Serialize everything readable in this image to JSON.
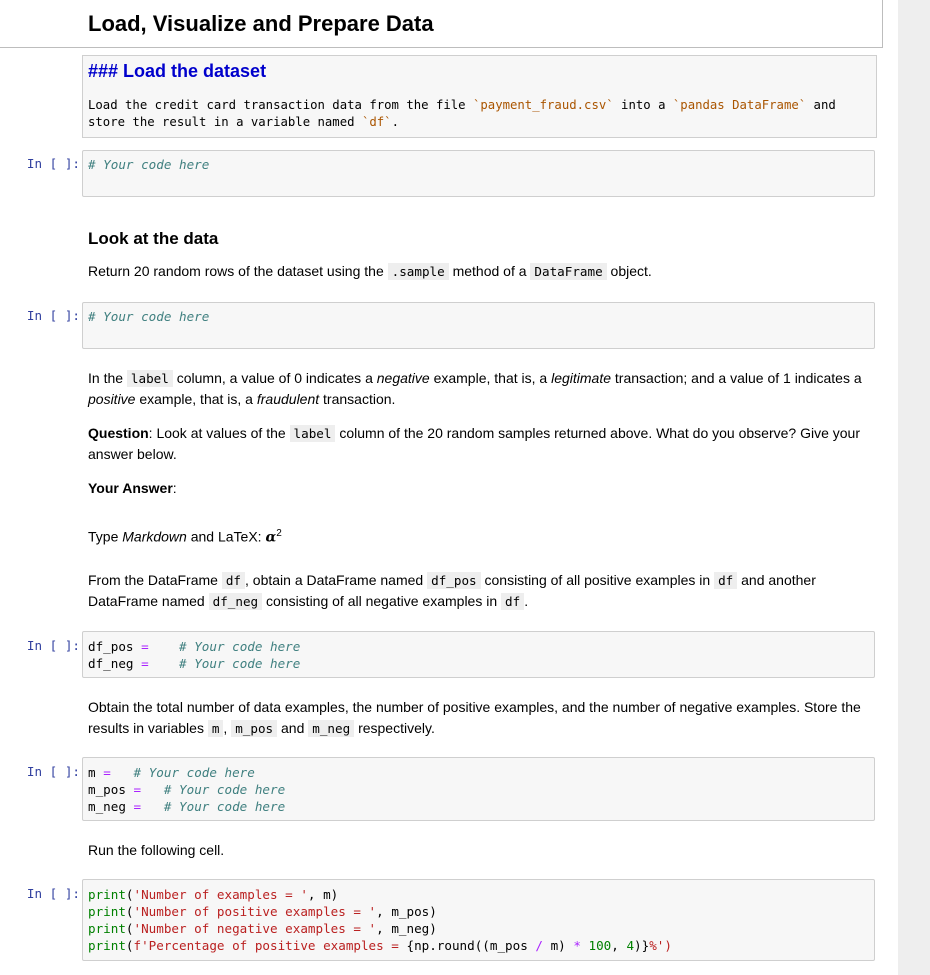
{
  "notebook": {
    "section_title": "Load, Visualize and Prepare Data",
    "prompt_label": "In [ ]:",
    "load_cell": {
      "heading": "### Load the dataset",
      "line1_a": "Load the credit card transaction data from the file ",
      "line1_file": "`payment_fraud.csv`",
      "line1_b": " into a ",
      "line1_df": "`pandas DataFrame`",
      "line1_c": " and",
      "line2_a": "store the result in a variable named ",
      "line2_var": "`df`",
      "line2_b": "."
    },
    "code_cell_1": {
      "comment": "# Your code here"
    },
    "look_section": {
      "heading": "Look at the data",
      "text_a": "Return 20 random rows of the dataset using the ",
      "code_sample": ".sample",
      "text_b": " method of a ",
      "code_dataframe": "DataFrame",
      "text_c": " object."
    },
    "code_cell_2": {
      "comment": "# Your code here"
    },
    "label_paragraph": {
      "t1": "In the ",
      "code_label": "label",
      "t2": " column, a value of 0 indicates a ",
      "negative": "negative",
      "t3": " example, that is, a ",
      "legitimate": "legitimate",
      "t4": " transaction; and a value of 1 indicates a",
      "positive": "positive",
      "t5": " example, that is, a ",
      "fraudulent": "fraudulent",
      "t6": " transaction."
    },
    "question": {
      "bold": "Question",
      "t1": ": Look at values of the ",
      "code_label": "label",
      "t2": " column of the 20 random samples returned above. What do you observe? Give your",
      "t3": "answer below."
    },
    "answer": {
      "bold": "Your Answer",
      "colon": ":"
    },
    "markdown_hint": {
      "t1": "Type ",
      "italic": "Markdown",
      "t2": " and LaTeX: ",
      "alpha": "α",
      "sup": "2"
    },
    "split_paragraph": {
      "t1": "From the DataFrame ",
      "df": "df",
      "t2": ", obtain a DataFrame named ",
      "df_pos": "df_pos",
      "t3": " consisting of all positive examples in ",
      "df2": "df",
      "t4": " and another",
      "t5": "DataFrame named ",
      "df_neg": "df_neg",
      "t6": " consisting of all negative examples in ",
      "df3": "df",
      "t7": "."
    },
    "code_cell_3": {
      "l1_var": "df_pos",
      "l1_op": "=",
      "l1_comment": "# Your code here",
      "l2_var": "df_neg",
      "l2_op": "=",
      "l2_comment": "# Your code here"
    },
    "count_paragraph": {
      "t1": "Obtain the total number of data examples, the number of positive examples, and the number of negative examples. Store the",
      "t2": "results in variables ",
      "m": "m",
      "t3": ", ",
      "m_pos": "m_pos",
      "t4": " and ",
      "m_neg": "m_neg",
      "t5": " respectively."
    },
    "code_cell_4": {
      "l1_var": "m",
      "l1_op": "=",
      "l1_comment": "# Your code here",
      "l2_var": "m_pos",
      "l2_op": "=",
      "l2_comment": "# Your code here",
      "l3_var": "m_neg",
      "l3_op": "=",
      "l3_comment": "# Your code here"
    },
    "run_text": "Run the following cell.",
    "code_cell_5": {
      "l1_fn": "print",
      "l1_str": "'Number of examples = '",
      "l1_rest": ", m)",
      "l2_fn": "print",
      "l2_str": "'Number of positive examples = '",
      "l2_rest": ", m_pos)",
      "l3_fn": "print",
      "l3_str": "'Number of negative examples = '",
      "l3_rest": ", m_neg)",
      "l4_fn": "print",
      "l4_str_a": "f'Percentage of positive examples = ",
      "l4_expr_a": "{np.round((m_pos ",
      "l4_div": "/",
      "l4_expr_b": " m) ",
      "l4_mul": "*",
      "l4_num": "100",
      "l4_expr_c": ", ",
      "l4_num2": "4",
      "l4_expr_d": ")}",
      "l4_str_b": "%')",
      "l4_paren": ")"
    }
  }
}
